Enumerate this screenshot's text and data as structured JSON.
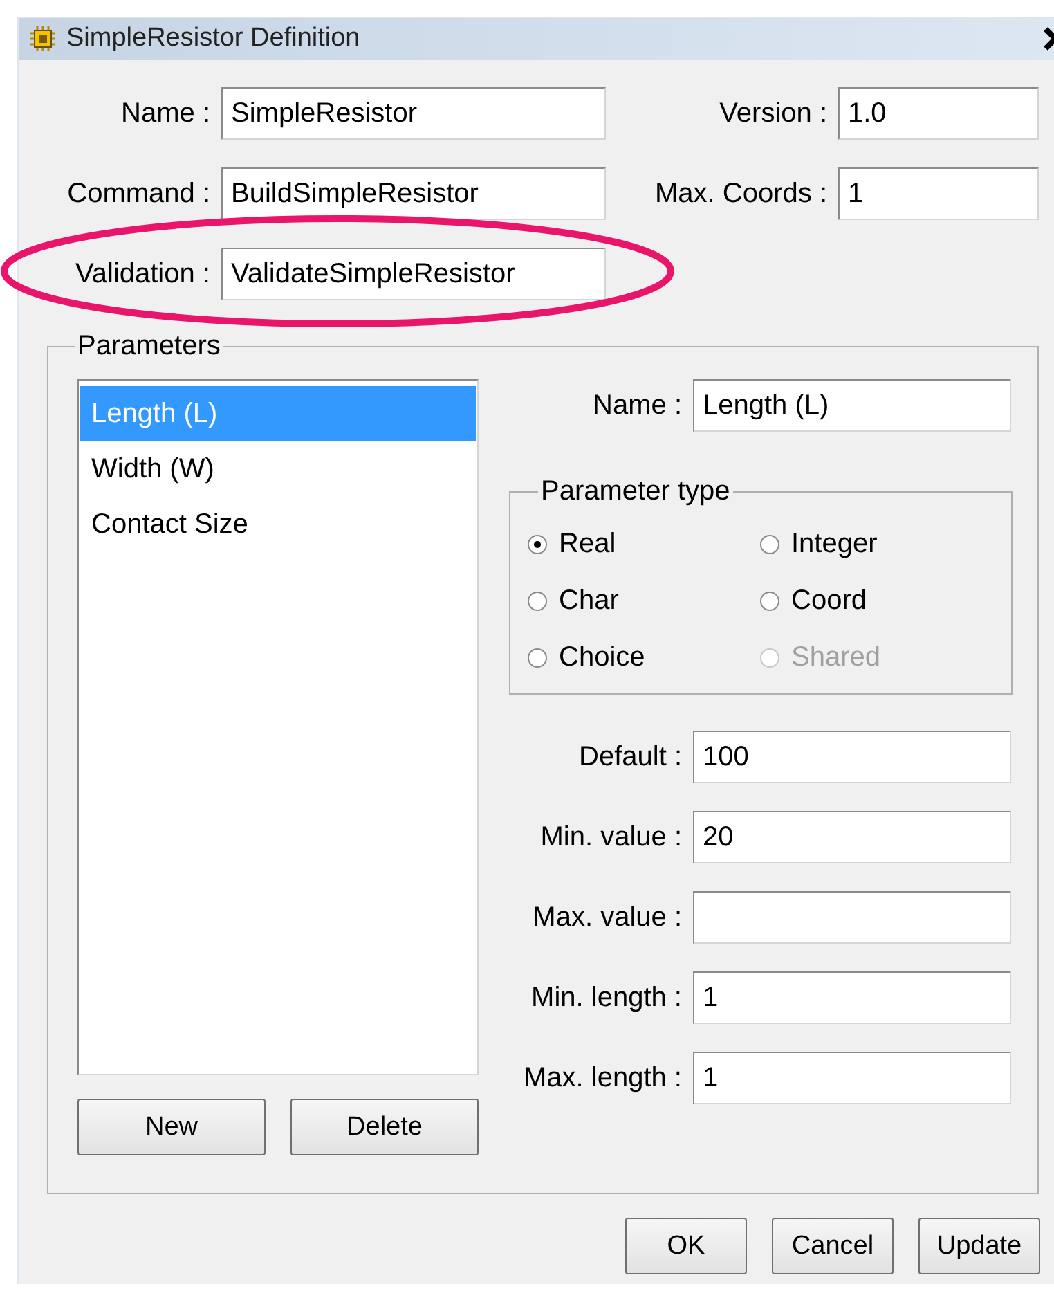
{
  "window": {
    "title": "SimpleResistor Definition"
  },
  "fields": [
    {
      "label": "Name :",
      "value": "SimpleResistor",
      "highlighted": false
    },
    {
      "label": "Version :",
      "value": "1.0",
      "highlighted": false
    },
    {
      "label": "Command :",
      "value": "BuildSimpleResistor",
      "highlighted": false
    },
    {
      "label": "Max. Coords :",
      "value": "1",
      "highlighted": false
    },
    {
      "label": "Validation :",
      "value": "ValidateSimpleResistor",
      "highlighted": true
    }
  ],
  "parameters": {
    "title": "Parameters",
    "items": [
      {
        "label": "Length (L)",
        "selected": true
      },
      {
        "label": "Width (W)",
        "selected": false
      },
      {
        "label": "Contact Size",
        "selected": false
      }
    ],
    "buttons": [
      "New",
      "Delete"
    ],
    "name": {
      "label": "Name :",
      "value": "Length (L)"
    },
    "parameter_type": {
      "title": "Parameter type",
      "options": [
        {
          "label": "Real",
          "selected": true,
          "disabled": false
        },
        {
          "label": "Integer",
          "selected": false,
          "disabled": false
        },
        {
          "label": "Char",
          "selected": false,
          "disabled": false
        },
        {
          "label": "Coord",
          "selected": false,
          "disabled": false
        },
        {
          "label": "Choice",
          "selected": false,
          "disabled": false
        },
        {
          "label": "Shared",
          "selected": false,
          "disabled": true
        }
      ]
    },
    "fields": [
      {
        "label": "Default :",
        "value": "100"
      },
      {
        "label": "Min. value :",
        "value": "20"
      },
      {
        "label": "Max. value :"
      },
      {
        "label": "Min. length :",
        "value": "1"
      },
      {
        "label": "Max. length :",
        "value": "1"
      }
    ]
  },
  "buttons": [
    "OK",
    "Cancel",
    "Update"
  ]
}
